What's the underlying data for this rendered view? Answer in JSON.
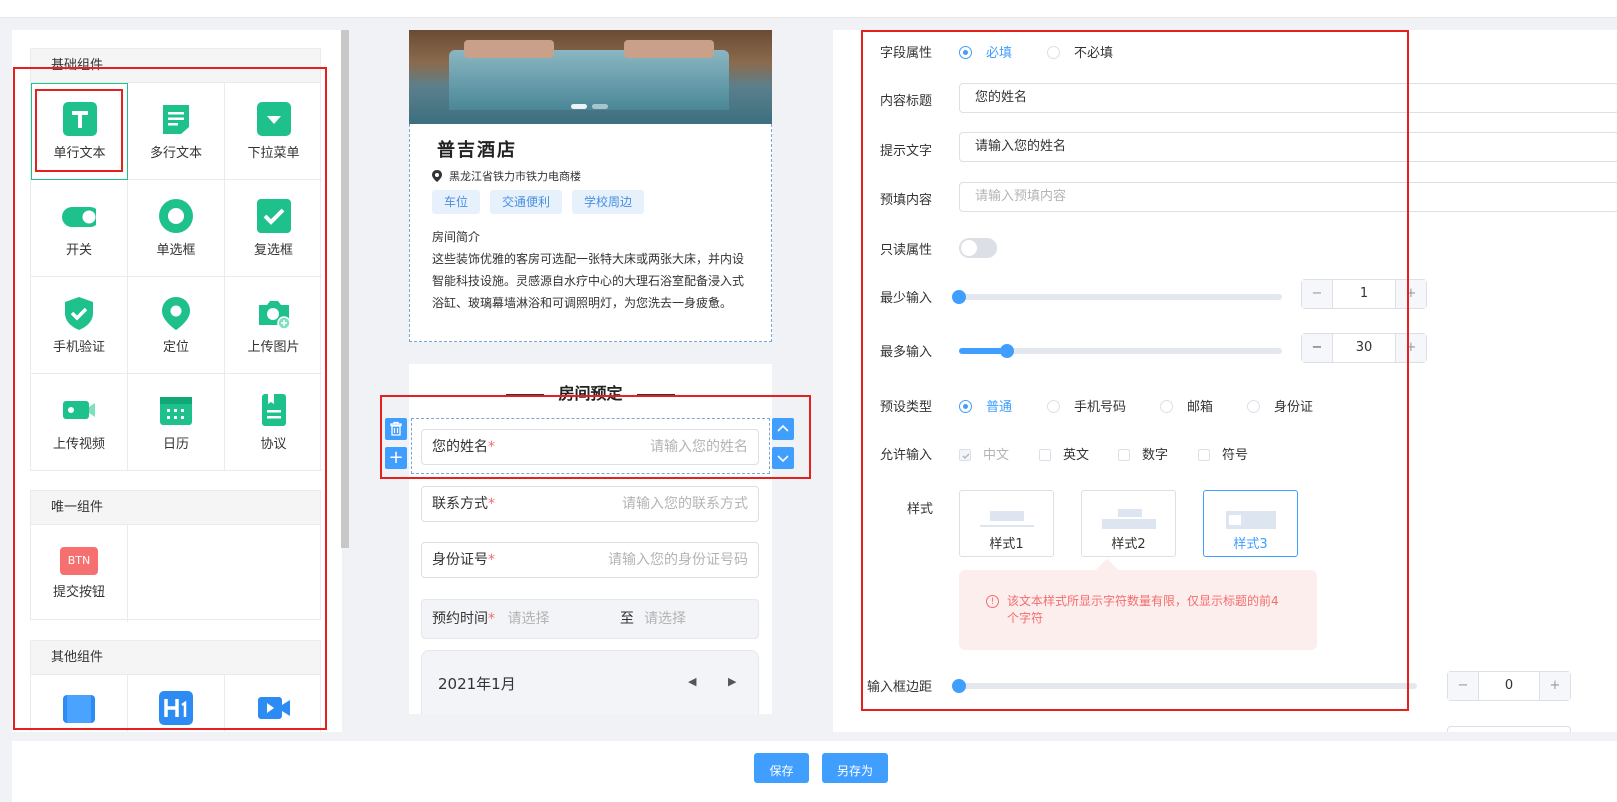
{
  "colors": {
    "accent": "#409eff",
    "component_green": "#1ec08c",
    "danger": "#e4211c",
    "warn_bg": "#fdeeee",
    "warn_text": "#f56c6c"
  },
  "left": {
    "basic_title": "基础组件",
    "basic_items": [
      {
        "label": "单行文本",
        "icon": "single-line-text-icon"
      },
      {
        "label": "多行文本",
        "icon": "multi-line-text-icon"
      },
      {
        "label": "下拉菜单",
        "icon": "dropdown-icon"
      },
      {
        "label": "开关",
        "icon": "toggle-icon"
      },
      {
        "label": "单选框",
        "icon": "radio-icon"
      },
      {
        "label": "复选框",
        "icon": "checkbox-icon"
      },
      {
        "label": "手机验证",
        "icon": "shield-check-icon"
      },
      {
        "label": "定位",
        "icon": "location-pin-icon"
      },
      {
        "label": "上传图片",
        "icon": "camera-icon"
      },
      {
        "label": "上传视频",
        "icon": "video-icon"
      },
      {
        "label": "日历",
        "icon": "calendar-icon"
      },
      {
        "label": "协议",
        "icon": "document-icon"
      }
    ],
    "unique_title": "唯一组件",
    "submit_btn_icon_text": "BTN",
    "submit_btn_label": "提交按钮",
    "other_title": "其他组件"
  },
  "phone": {
    "hotel_name": "普吉酒店",
    "address": "黑龙江省铁力市铁力电商楼",
    "tags": [
      "车位",
      "交通便利",
      "学校周边"
    ],
    "intro_title": "房间简介",
    "intro_text": "这些装饰优雅的客房可选配一张特大床或两张大床，并内设智能科技设施。灵感源自水疗中心的大理石浴室配备浸入式浴缸、玻璃幕墙淋浴和可调照明灯，为您洗去一身疲惫。",
    "section_title": "房间预定",
    "fields": [
      {
        "label": "您的姓名",
        "placeholder": "请输入您的姓名"
      },
      {
        "label": "联系方式",
        "placeholder": "请输入您的联系方式"
      },
      {
        "label": "身份证号",
        "placeholder": "请输入您的身份证号码"
      }
    ],
    "date_label": "预约时间",
    "date_start_ph": "请选择",
    "date_to": "至",
    "date_end_ph": "请选择",
    "calendar_month": "2021年1月",
    "required_mark": "*"
  },
  "right": {
    "field_attr_label": "字段属性",
    "required_on": "必填",
    "required_off": "不必填",
    "title_label": "内容标题",
    "title_value": "您的姓名",
    "hint_label": "提示文字",
    "hint_value": "请输入您的姓名",
    "prefill_label": "预填内容",
    "prefill_ph": "请输入预填内容",
    "readonly_label": "只读属性",
    "min_label": "最少输入",
    "min_value": "1",
    "max_label": "最多输入",
    "max_value": "30",
    "preset_label": "预设类型",
    "preset_options": [
      "普通",
      "手机号码",
      "邮箱",
      "身份证"
    ],
    "allow_label": "允许输入",
    "allow_options": [
      "中文",
      "英文",
      "数字",
      "符号"
    ],
    "style_label": "样式",
    "styles": [
      "样式1",
      "样式2",
      "样式3"
    ],
    "warning": "该文本样式所显示字符数量有限，仅显示标题的前4个字符",
    "margin_label": "输入框边距",
    "margin_value": "0",
    "minus": "−",
    "plus": "+"
  },
  "bottom": {
    "save": "保存",
    "save_as": "另存为"
  }
}
